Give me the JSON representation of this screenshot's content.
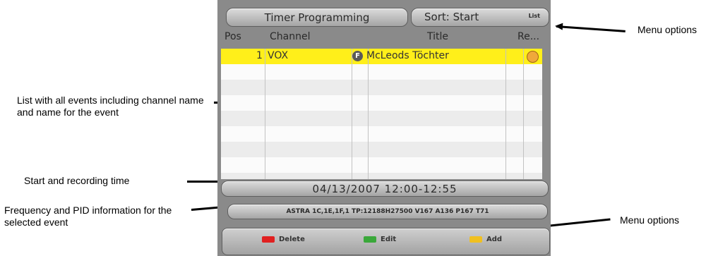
{
  "annotations": {
    "menu_options_top": "Menu options",
    "list_events": "List with all events including channel name and name for the event",
    "start_recording": "Start and recording time",
    "freq_pid": "Frequency and PID information for the selected event",
    "menu_options_bottom": "Menu options"
  },
  "header": {
    "title": "Timer Programming",
    "sort_label": "Sort: Start",
    "list_label": "List"
  },
  "table": {
    "columns": [
      "Pos",
      "Channel",
      "Title",
      "Re..."
    ],
    "rows": [
      {
        "pos": "1",
        "channel": "VOX",
        "title_icon": "F",
        "title": "McLeods Töchter",
        "recording": true
      }
    ]
  },
  "datetime": "04/13/2007 12:00-12:55",
  "frequency_info": "ASTRA 1C,1E,1F,1 TP:12188H27500 V167 A136 P167 T71",
  "menu": {
    "delete_label": "Delete",
    "edit_label": "Edit",
    "add_label": "Add"
  },
  "colors": {
    "selected_row": "#ffef1a",
    "delete": "#e02020",
    "edit": "#3aa83a",
    "add": "#f0c020",
    "record": "#f0a83a"
  },
  "icons": [
    "arrow-left-icon",
    "arrow-right-icon",
    "f-icon",
    "record-icon"
  ]
}
